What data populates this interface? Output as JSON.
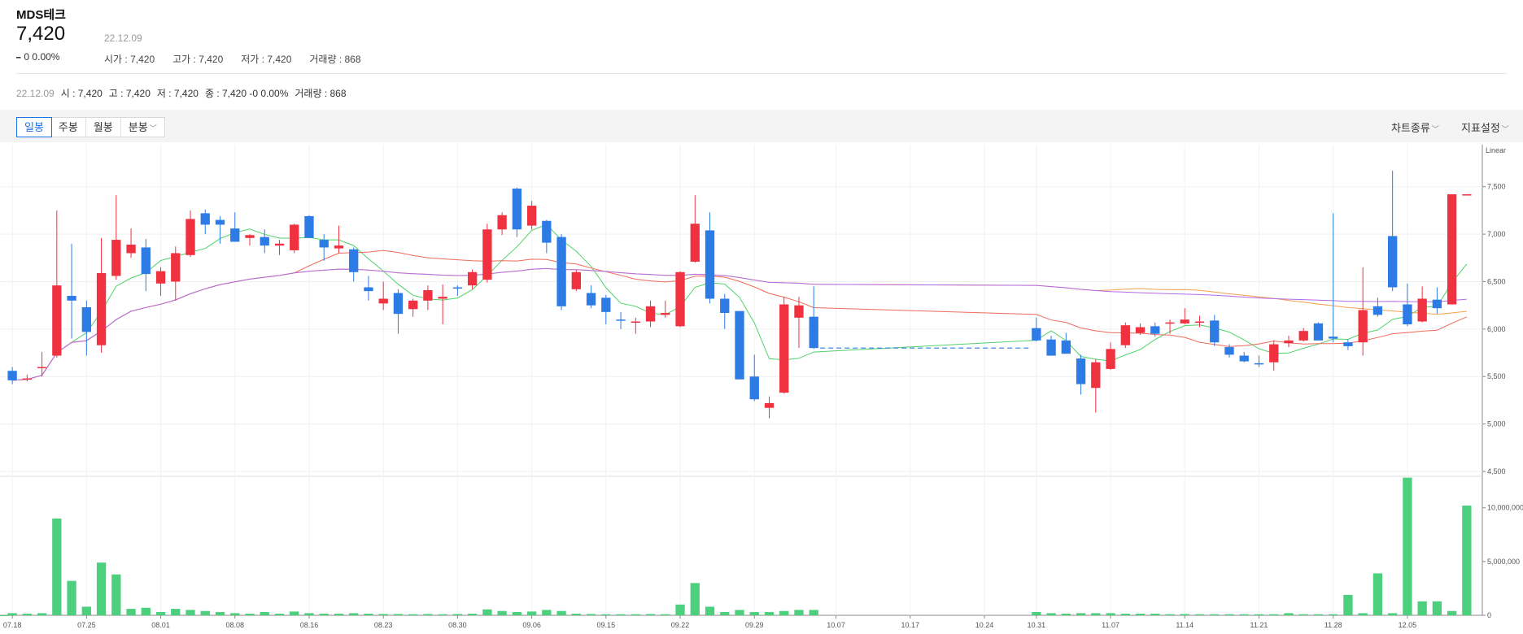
{
  "stock": {
    "name": "MDS테크",
    "price": "7,420",
    "change_symbol": "━",
    "change_text": "0 0.00%",
    "date": "22.12.09",
    "open": "시가 : 7,420",
    "high": "고가 : 7,420",
    "low": "저가 : 7,420",
    "volume": "거래량 : 868"
  },
  "ohlc_line": {
    "date": "22.12.09",
    "open": "시 : 7,420",
    "high": "고 : 7,420",
    "low": "저 : 7,420",
    "close": "종 : 7,420 -0 0.00%",
    "volume": "거래량 : 868"
  },
  "toolbar": {
    "tabs": [
      "일봉",
      "주봉",
      "월봉",
      "분봉"
    ],
    "active_tab": "일봉",
    "chart_type_label": "차트종류",
    "indicator_label": "지표설정"
  },
  "colors": {
    "up": "#f0313f",
    "down": "#2d7be5",
    "volume": "#4cd07d",
    "ma5": "#4ed26a",
    "ma20": "#f06a5a",
    "ma60": "#f5a04c",
    "ma120": "#b36ae8"
  },
  "chart_data": {
    "type": "candlestick",
    "scale_label": "Linear",
    "price_ticks": [
      "7,500",
      "7,000",
      "6,500",
      "6,000",
      "5,500",
      "5,000",
      "4,500"
    ],
    "price_range": [
      4500,
      7900
    ],
    "volume_ticks": [
      "10,000,000",
      "5,000,000",
      "0"
    ],
    "volume_range": [
      0,
      13000000
    ],
    "x_labels": [
      "07.18",
      "07.25",
      "08.01",
      "08.08",
      "08.16",
      "08.23",
      "08.30",
      "09.06",
      "09.15",
      "09.22",
      "09.29",
      "10.07",
      "10.17",
      "10.24",
      "10.31",
      "11.07",
      "11.14",
      "11.21",
      "11.28",
      "12.05"
    ],
    "candles": [
      {
        "d": "07.18",
        "o": 5560,
        "h": 5600,
        "l": 5420,
        "c": 5460
      },
      {
        "d": "07.19",
        "o": 5480,
        "h": 5520,
        "l": 5450,
        "c": 5480
      },
      {
        "d": "07.20",
        "o": 5600,
        "h": 5760,
        "l": 5500,
        "c": 5600
      },
      {
        "d": "07.21",
        "o": 5720,
        "h": 7250,
        "l": 5700,
        "c": 6460
      },
      {
        "d": "07.22",
        "o": 6350,
        "h": 6900,
        "l": 5900,
        "c": 6300
      },
      {
        "d": "07.25",
        "o": 6230,
        "h": 6300,
        "l": 5720,
        "c": 5970
      },
      {
        "d": "07.26",
        "o": 5830,
        "h": 6960,
        "l": 5750,
        "c": 6590
      },
      {
        "d": "07.27",
        "o": 6560,
        "h": 7410,
        "l": 6520,
        "c": 6940
      },
      {
        "d": "07.28",
        "o": 6800,
        "h": 7060,
        "l": 6750,
        "c": 6890
      },
      {
        "d": "07.29",
        "o": 6860,
        "h": 6950,
        "l": 6400,
        "c": 6580
      },
      {
        "d": "08.01",
        "o": 6480,
        "h": 6650,
        "l": 6350,
        "c": 6610
      },
      {
        "d": "08.02",
        "o": 6500,
        "h": 6870,
        "l": 6300,
        "c": 6800
      },
      {
        "d": "08.03",
        "o": 6780,
        "h": 7250,
        "l": 6760,
        "c": 7160
      },
      {
        "d": "08.04",
        "o": 7220,
        "h": 7260,
        "l": 7000,
        "c": 7100
      },
      {
        "d": "08.05",
        "o": 7150,
        "h": 7190,
        "l": 6900,
        "c": 7100
      },
      {
        "d": "08.08",
        "o": 7060,
        "h": 7230,
        "l": 6920,
        "c": 6920
      },
      {
        "d": "08.09",
        "o": 6960,
        "h": 7000,
        "l": 6880,
        "c": 6990
      },
      {
        "d": "08.10",
        "o": 6970,
        "h": 7050,
        "l": 6800,
        "c": 6880
      },
      {
        "d": "08.11",
        "o": 6880,
        "h": 6940,
        "l": 6780,
        "c": 6900
      },
      {
        "d": "08.12",
        "o": 6830,
        "h": 7110,
        "l": 6800,
        "c": 7100
      },
      {
        "d": "08.16",
        "o": 7190,
        "h": 7200,
        "l": 6960,
        "c": 6960
      },
      {
        "d": "08.17",
        "o": 6940,
        "h": 7000,
        "l": 6720,
        "c": 6860
      },
      {
        "d": "08.18",
        "o": 6850,
        "h": 7090,
        "l": 6800,
        "c": 6880
      },
      {
        "d": "08.19",
        "o": 6840,
        "h": 6860,
        "l": 6500,
        "c": 6600
      },
      {
        "d": "08.22",
        "o": 6440,
        "h": 6560,
        "l": 6300,
        "c": 6400
      },
      {
        "d": "08.23",
        "o": 6270,
        "h": 6500,
        "l": 6200,
        "c": 6320
      },
      {
        "d": "08.24",
        "o": 6380,
        "h": 6420,
        "l": 5950,
        "c": 6160
      },
      {
        "d": "08.25",
        "o": 6210,
        "h": 6320,
        "l": 6130,
        "c": 6300
      },
      {
        "d": "08.26",
        "o": 6300,
        "h": 6460,
        "l": 6200,
        "c": 6410
      },
      {
        "d": "08.29",
        "o": 6320,
        "h": 6470,
        "l": 6050,
        "c": 6340
      },
      {
        "d": "08.30",
        "o": 6440,
        "h": 6460,
        "l": 6350,
        "c": 6430
      },
      {
        "d": "08.31",
        "o": 6460,
        "h": 6630,
        "l": 6420,
        "c": 6600
      },
      {
        "d": "09.01",
        "o": 6520,
        "h": 7110,
        "l": 6490,
        "c": 7050
      },
      {
        "d": "09.02",
        "o": 7050,
        "h": 7230,
        "l": 6990,
        "c": 7200
      },
      {
        "d": "09.05",
        "o": 7480,
        "h": 7490,
        "l": 6970,
        "c": 7050
      },
      {
        "d": "09.06",
        "o": 7090,
        "h": 7350,
        "l": 7050,
        "c": 7300
      },
      {
        "d": "09.07",
        "o": 7140,
        "h": 7150,
        "l": 6800,
        "c": 6910
      },
      {
        "d": "09.08",
        "o": 6970,
        "h": 7000,
        "l": 6200,
        "c": 6240
      },
      {
        "d": "09.13",
        "o": 6420,
        "h": 6620,
        "l": 6400,
        "c": 6600
      },
      {
        "d": "09.14",
        "o": 6380,
        "h": 6460,
        "l": 6220,
        "c": 6250
      },
      {
        "d": "09.15",
        "o": 6330,
        "h": 6360,
        "l": 6050,
        "c": 6180
      },
      {
        "d": "09.16",
        "o": 6100,
        "h": 6180,
        "l": 6000,
        "c": 6090
      },
      {
        "d": "09.19",
        "o": 6080,
        "h": 6120,
        "l": 5950,
        "c": 6080
      },
      {
        "d": "09.20",
        "o": 6080,
        "h": 6300,
        "l": 6020,
        "c": 6240
      },
      {
        "d": "09.21",
        "o": 6150,
        "h": 6300,
        "l": 6120,
        "c": 6170
      },
      {
        "d": "09.22",
        "o": 6030,
        "h": 6610,
        "l": 6020,
        "c": 6600
      },
      {
        "d": "09.23",
        "o": 6710,
        "h": 7410,
        "l": 6700,
        "c": 7110
      },
      {
        "d": "09.26",
        "o": 7040,
        "h": 7230,
        "l": 6270,
        "c": 6320
      },
      {
        "d": "09.27",
        "o": 6320,
        "h": 6370,
        "l": 6000,
        "c": 6170
      },
      {
        "d": "09.28",
        "o": 6190,
        "h": 6190,
        "l": 5470,
        "c": 5470
      },
      {
        "d": "09.29",
        "o": 5500,
        "h": 5730,
        "l": 5240,
        "c": 5260
      },
      {
        "d": "09.30",
        "o": 5170,
        "h": 5290,
        "l": 5060,
        "c": 5220
      },
      {
        "d": "10.04",
        "o": 5330,
        "h": 6340,
        "l": 5320,
        "c": 6260
      },
      {
        "d": "10.05",
        "o": 6120,
        "h": 6340,
        "l": 5800,
        "c": 6250
      },
      {
        "d": "10.06",
        "o": 6130,
        "h": 6450,
        "l": 5790,
        "c": 5800
      },
      {
        "d": "10.31",
        "o": 6010,
        "h": 6120,
        "l": 5870,
        "c": 5880
      },
      {
        "d": "11.01",
        "o": 5890,
        "h": 5930,
        "l": 5720,
        "c": 5720
      },
      {
        "d": "11.02",
        "o": 5880,
        "h": 5960,
        "l": 5740,
        "c": 5740
      },
      {
        "d": "11.03",
        "o": 5690,
        "h": 5730,
        "l": 5310,
        "c": 5420
      },
      {
        "d": "11.04",
        "o": 5380,
        "h": 5680,
        "l": 5120,
        "c": 5650
      },
      {
        "d": "11.07",
        "o": 5580,
        "h": 5860,
        "l": 5570,
        "c": 5790
      },
      {
        "d": "11.08",
        "o": 5830,
        "h": 6070,
        "l": 5800,
        "c": 6040
      },
      {
        "d": "11.09",
        "o": 5960,
        "h": 6060,
        "l": 5940,
        "c": 6020
      },
      {
        "d": "11.10",
        "o": 6030,
        "h": 6070,
        "l": 5920,
        "c": 5950
      },
      {
        "d": "11.11",
        "o": 6060,
        "h": 6100,
        "l": 5950,
        "c": 6070
      },
      {
        "d": "11.14",
        "o": 6060,
        "h": 6220,
        "l": 6050,
        "c": 6100
      },
      {
        "d": "11.15",
        "o": 6080,
        "h": 6140,
        "l": 6020,
        "c": 6080
      },
      {
        "d": "11.16",
        "o": 6090,
        "h": 6150,
        "l": 5820,
        "c": 5860
      },
      {
        "d": "11.17",
        "o": 5810,
        "h": 5840,
        "l": 5700,
        "c": 5730
      },
      {
        "d": "11.18",
        "o": 5720,
        "h": 5760,
        "l": 5650,
        "c": 5660
      },
      {
        "d": "11.21",
        "o": 5640,
        "h": 5720,
        "l": 5600,
        "c": 5630
      },
      {
        "d": "11.22",
        "o": 5650,
        "h": 5880,
        "l": 5560,
        "c": 5840
      },
      {
        "d": "11.23",
        "o": 5850,
        "h": 5930,
        "l": 5810,
        "c": 5880
      },
      {
        "d": "11.24",
        "o": 5880,
        "h": 6010,
        "l": 5870,
        "c": 5980
      },
      {
        "d": "11.25",
        "o": 6060,
        "h": 6070,
        "l": 5880,
        "c": 5880
      },
      {
        "d": "11.28",
        "o": 5920,
        "h": 7220,
        "l": 5860,
        "c": 5900
      },
      {
        "d": "11.29",
        "o": 5860,
        "h": 5890,
        "l": 5780,
        "c": 5820
      },
      {
        "d": "11.30",
        "o": 5860,
        "h": 6650,
        "l": 5720,
        "c": 6200
      },
      {
        "d": "12.01",
        "o": 6240,
        "h": 6330,
        "l": 6130,
        "c": 6150
      },
      {
        "d": "12.02",
        "o": 6980,
        "h": 7670,
        "l": 6400,
        "c": 6440
      },
      {
        "d": "12.05",
        "o": 6260,
        "h": 6480,
        "l": 6030,
        "c": 6050
      },
      {
        "d": "12.06",
        "o": 6080,
        "h": 6450,
        "l": 6070,
        "c": 6320
      },
      {
        "d": "12.07",
        "o": 6310,
        "h": 6440,
        "l": 6160,
        "c": 6220
      },
      {
        "d": "12.08",
        "o": 6260,
        "h": 7420,
        "l": 6260,
        "c": 7420
      },
      {
        "d": "12.09",
        "o": 7420,
        "h": 7420,
        "l": 7420,
        "c": 7420
      }
    ],
    "volumes": [
      200000,
      150000,
      200000,
      9000000,
      3200000,
      800000,
      4900000,
      3800000,
      600000,
      700000,
      300000,
      600000,
      500000,
      400000,
      300000,
      200000,
      150000,
      300000,
      150000,
      350000,
      200000,
      150000,
      150000,
      200000,
      150000,
      120000,
      120000,
      100000,
      120000,
      100000,
      120000,
      150000,
      550000,
      400000,
      300000,
      350000,
      500000,
      400000,
      150000,
      120000,
      100000,
      100000,
      100000,
      120000,
      100000,
      1000000,
      3000000,
      800000,
      300000,
      500000,
      300000,
      300000,
      400000,
      500000,
      500000,
      300000,
      200000,
      150000,
      200000,
      200000,
      200000,
      150000,
      150000,
      150000,
      100000,
      120000,
      100000,
      100000,
      100000,
      100000,
      100000,
      100000,
      200000,
      100000,
      100000,
      100000,
      1900000,
      200000,
      3900000,
      200000,
      12800000,
      1300000,
      1300000,
      400000,
      10200000,
      868
    ]
  }
}
